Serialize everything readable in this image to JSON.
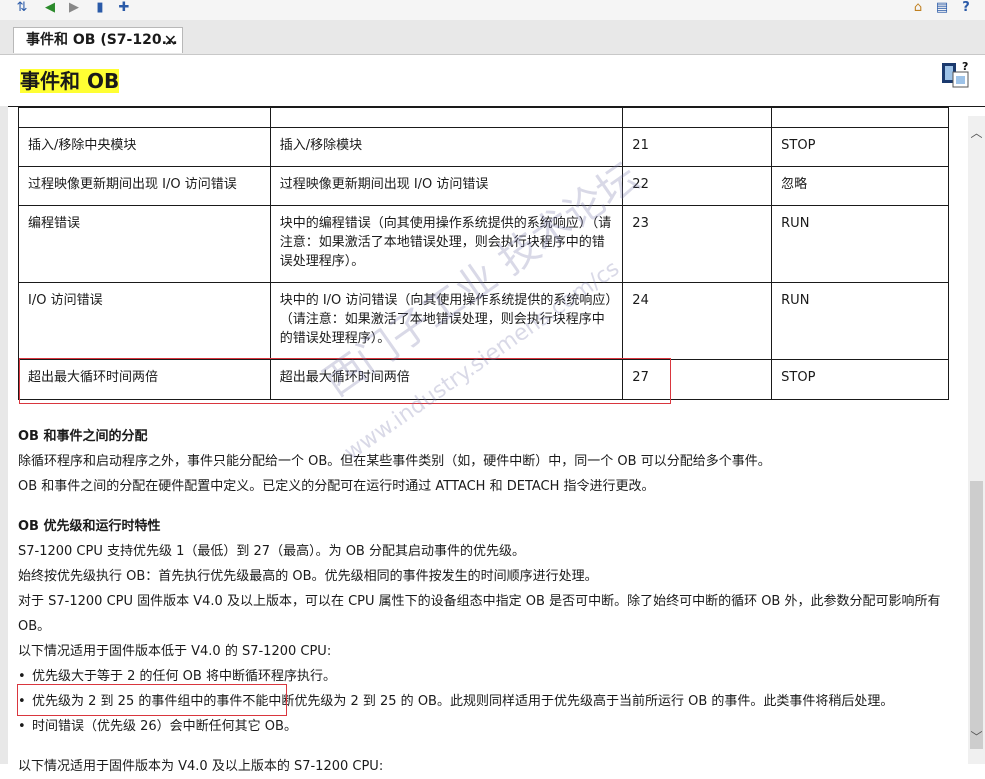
{
  "toolbar": {
    "icons": [
      "sync-icon",
      "back-icon",
      "forward-icon",
      "bookmark-icon",
      "favorites-icon",
      "home-icon",
      "print-icon",
      "help-icon"
    ]
  },
  "tab": {
    "label": "事件和 OB (S7-120...",
    "close": "✕"
  },
  "page": {
    "title": "事件和 OB"
  },
  "table": {
    "rows": [
      {
        "event": "",
        "desc": "",
        "ob": "",
        "response": ""
      },
      {
        "event": "插入/移除中央模块",
        "desc": "插入/移除模块",
        "ob": "21",
        "response": "STOP"
      },
      {
        "event": "过程映像更新期间出现 I/O 访问错误",
        "desc": "过程映像更新期间出现 I/O 访问错误",
        "ob": "22",
        "response": "忽略"
      },
      {
        "event": "编程错误",
        "desc": "块中的编程错误（向其使用操作系统提供的系统响应）（请注意：如果激活了本地错误处理，则会执行块程序中的错误处理程序）。",
        "ob": "23",
        "response": "RUN"
      },
      {
        "event": "I/O 访问错误",
        "desc": "块中的 I/O 访问错误（向其使用操作系统提供的系统响应）（请注意：如果激活了本地错误处理，则会执行块程序中的错误处理程序）。",
        "ob": "24",
        "response": "RUN"
      },
      {
        "event": "超出最大循环时间两倍",
        "desc": "超出最大循环时间两倍",
        "ob": "27",
        "response": "STOP"
      }
    ]
  },
  "section1": {
    "heading": "OB 和事件之间的分配",
    "p1": "除循环程序和启动程序之外，事件只能分配给一个 OB。但在某些事件类别（如，硬件中断）中，同一个 OB 可以分配给多个事件。",
    "p2": "OB 和事件之间的分配在硬件配置中定义。已定义的分配可在运行时通过 ATTACH 和 DETACH 指令进行更改。"
  },
  "section2": {
    "heading": "OB 优先级和运行时特性",
    "p1": "S7-1200 CPU 支持优先级 1（最低）到 27（最高）。为 OB 分配其启动事件的优先级。",
    "p2": "始终按优先级执行 OB：首先执行优先级最高的 OB。优先级相同的事件按发生的时间顺序进行处理。",
    "p3": "对于 S7-1200 CPU 固件版本 V4.0 及以上版本，可以在 CPU 属性下的设备组态中指定 OB 是否可中断。除了始终可中断的循环 OB 外，此参数分配可影响所有 OB。",
    "p4": "以下情况适用于固件版本低于 V4.0 的 S7-1200 CPU:",
    "b1": "优先级大于等于 2 的任何 OB 将中断循环程序执行。",
    "b2": "优先级为 2 到 25 的事件组中的事件不能中断优先级为 2 到 25 的 OB。此规则同样适用于优先级高于当前所运行 OB 的事件。此类事件将稍后处理。",
    "b3": "时间错误（优先级 26）会中断任何其它 OB。",
    "p5": "以下情况适用于固件版本为 V4.0 及以上版本的 S7-1200 CPU:"
  },
  "watermark": {
    "line1": "西门子工业 技术论坛",
    "line2": "www.industry.siemens.com/cs"
  },
  "scrollbar": {
    "up": "︿",
    "down": "﹀"
  }
}
